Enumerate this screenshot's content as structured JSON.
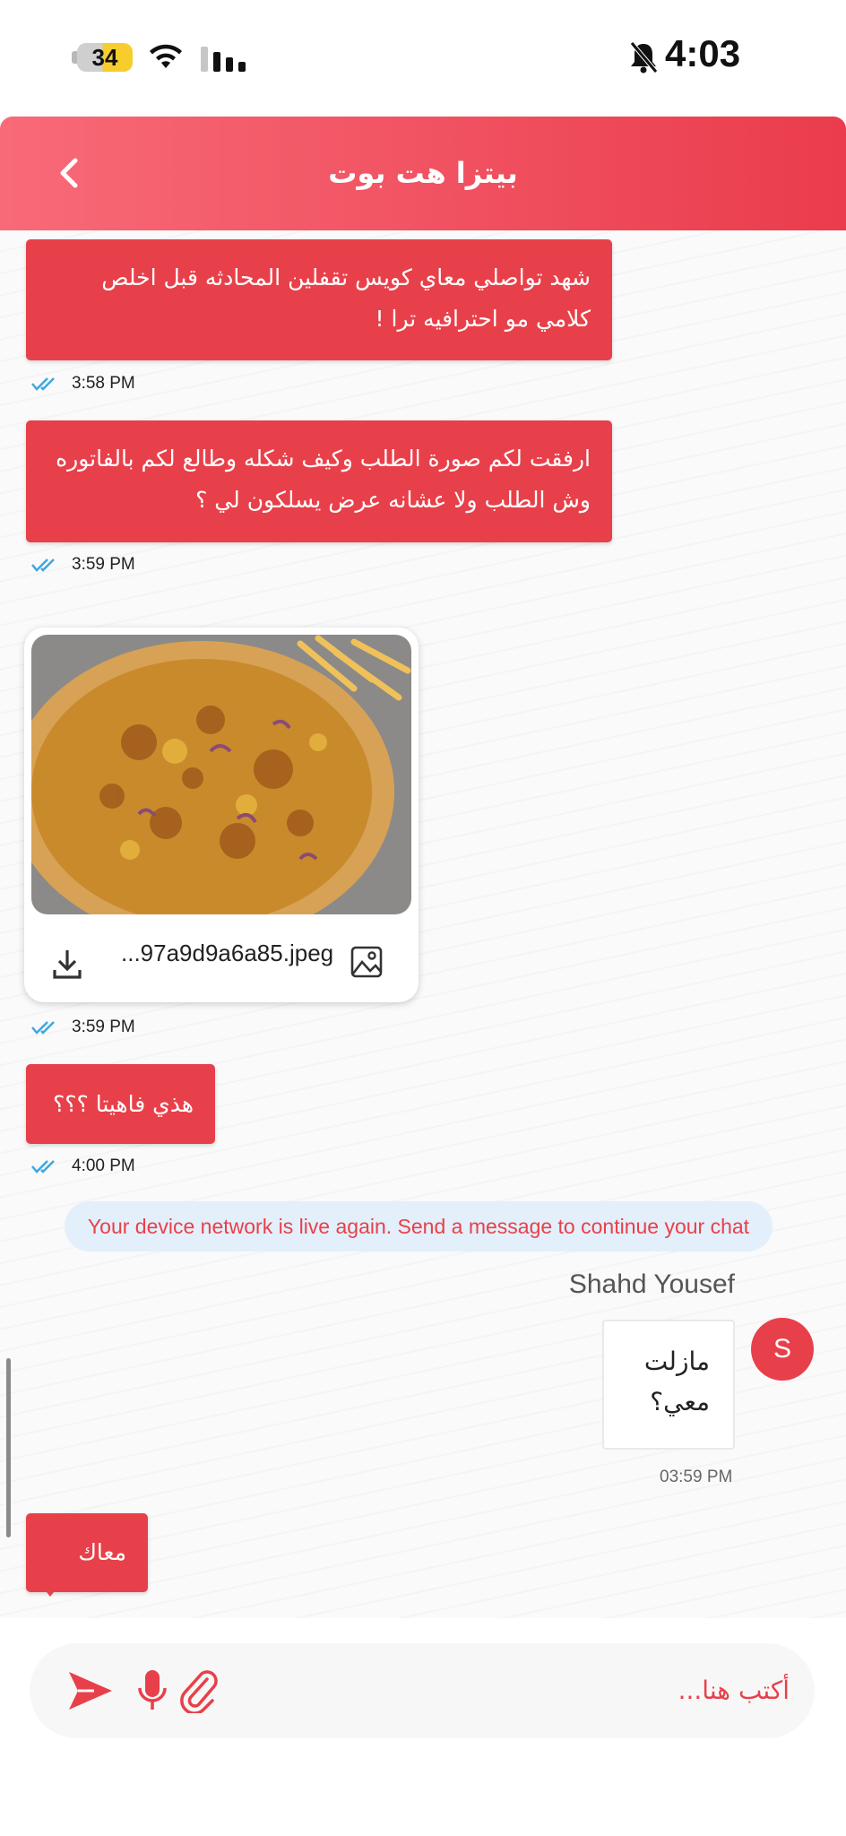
{
  "status_bar": {
    "battery_level": "34",
    "time": "4:03"
  },
  "header": {
    "title": "بيتزا هت بوت"
  },
  "messages": [
    {
      "text": "شهد تواصلي معاي كويس تقفلين المحادثه قبل اخلص كلامي مو احترافيه ترا !",
      "time": "3:58 PM"
    },
    {
      "text": "ارفقت لكم صورة الطلب وكيف شكله وطالع لكم بالفاتوره وش الطلب ولا عشانه عرض يسلكون لي ؟",
      "time": "3:59 PM"
    },
    {
      "attachment_name": "...97a9d9a6a85.jpeg",
      "time": "3:59 PM"
    },
    {
      "text": "هذي فاهيتا ؟؟؟",
      "time": "4:00 PM"
    }
  ],
  "notice": "Your device network is live again. Send a message to continue your chat",
  "user_message": {
    "sender": "Shahd Yousef",
    "avatar_letter": "S",
    "text": "مازلت معي؟",
    "time": "03:59 PM"
  },
  "last_reply": "معاك",
  "composer": {
    "placeholder": "أكتب هنا..."
  },
  "colors": {
    "accent": "#e8404a",
    "header_start": "#f86a78",
    "header_end": "#ea3c4c",
    "read_tick": "#3fa7e0"
  }
}
